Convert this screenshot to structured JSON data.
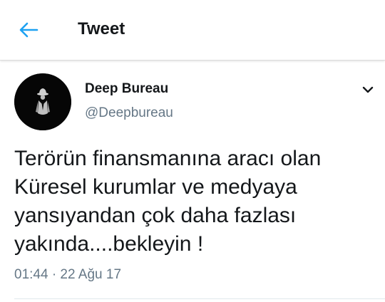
{
  "header": {
    "title": "Tweet",
    "back_icon": "arrow-left-icon"
  },
  "tweet": {
    "author": {
      "display_name": "Deep Bureau",
      "username": "@Deepbureau",
      "avatar_icon": "profile-avatar"
    },
    "text_lines": [
      "Terörün finansmanına aracı olan",
      "Küresel kurumlar ve medyaya",
      "yansıyandan çok daha fazlası",
      "yakında....bekleyin !"
    ],
    "timestamp": "01:44 · 22 Ağu 17",
    "menu_icon": "chevron-down-icon"
  },
  "colors": {
    "accent": "#1da1f2",
    "text_primary": "#14171a",
    "text_secondary": "#657786"
  }
}
